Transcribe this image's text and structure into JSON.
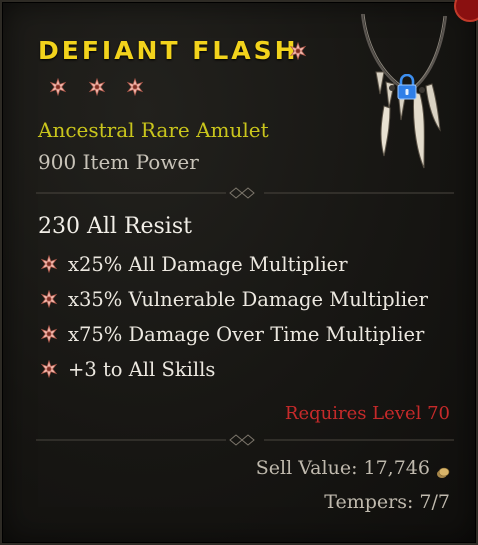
{
  "item": {
    "name": "Defiant Flash",
    "greater_affix_count": 3,
    "type_line": "Ancestral Rare Amulet",
    "item_power": "900 Item Power",
    "base_stat": "230 All Resist",
    "affixes": [
      {
        "text": "x25% All Damage Multiplier",
        "greater": true
      },
      {
        "text": "x35% Vulnerable Damage Multiplier",
        "greater": true
      },
      {
        "text": "x75% Damage Over Time Multiplier",
        "greater": true
      },
      {
        "text": "+3 to All Skills",
        "greater": true
      }
    ],
    "requires_level": "Requires Level 70",
    "sell_value": "Sell Value: 17,746",
    "tempers": "Tempers: 7/7",
    "locked": true
  },
  "icons": {
    "greater_affix": "greater-affix-star-icon",
    "lock": "lock-icon",
    "gold": "gold-coin-icon"
  },
  "colors": {
    "title": "#f2d31c",
    "rarity": "#c9c51c",
    "greater_affix": "#f0b8ad",
    "requirement": "#c62a2a",
    "lock": "#3d8ff0"
  }
}
